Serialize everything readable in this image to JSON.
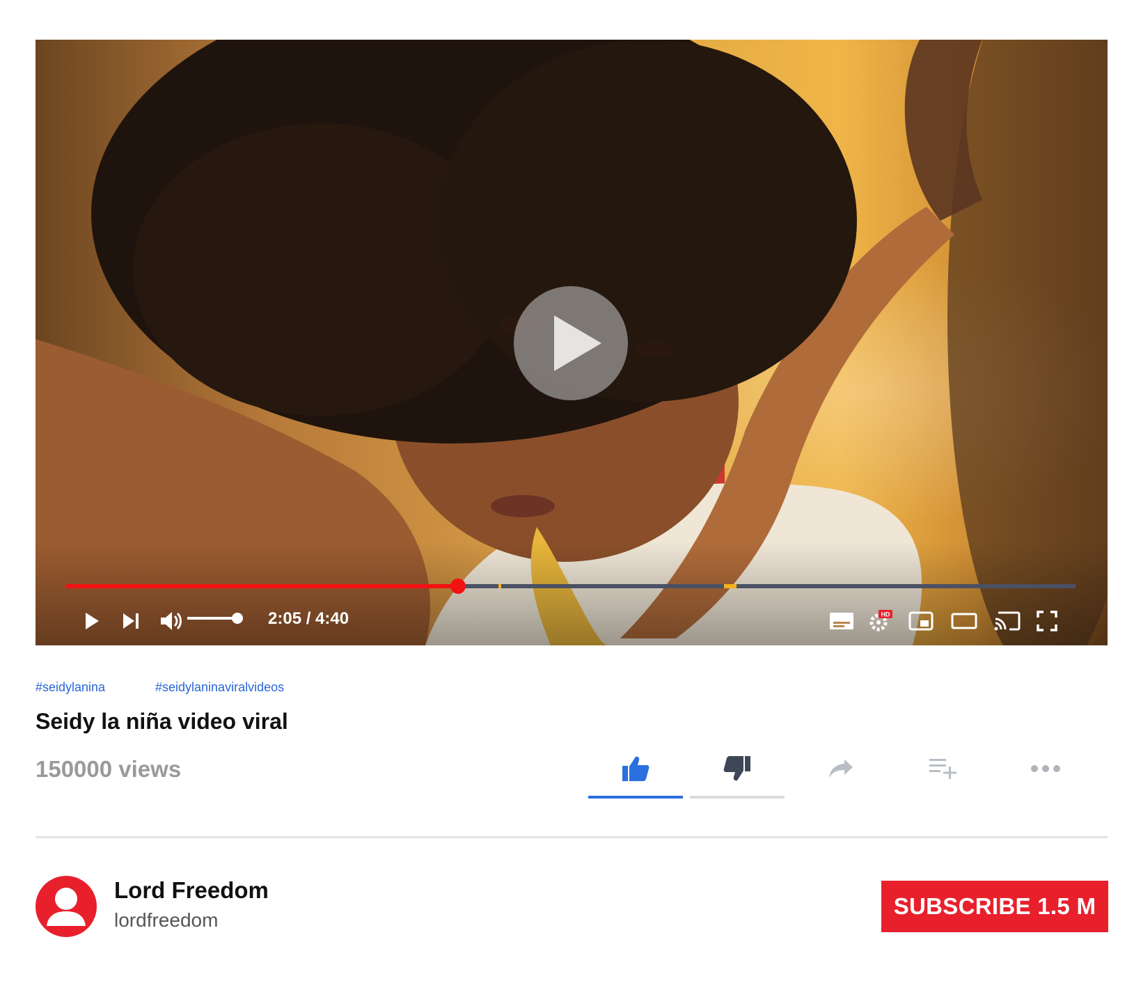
{
  "player": {
    "time_label": "2:05 / 4:40",
    "progress_fraction": 0.388,
    "volume_fraction": 1.0,
    "chapter_marks": [
      0.428,
      0.652
    ],
    "hd_badge": "HD",
    "controls": [
      "play-icon",
      "next-icon",
      "volume-icon",
      "subtitles-icon",
      "settings-icon",
      "miniplayer-icon",
      "theater-icon",
      "cast-icon",
      "fullscreen-icon"
    ]
  },
  "hashtags": [
    "#seidylanina",
    "#seidylaninaviralvideos"
  ],
  "video": {
    "title": "Seidy la niña video viral",
    "views": "150000 views"
  },
  "actions": [
    "like-icon",
    "dislike-icon",
    "share-icon",
    "add-to-playlist-icon",
    "more-icon"
  ],
  "channel": {
    "name": "Lord Freedom",
    "handle": "lordfreedom"
  },
  "subscribe": {
    "label": "SUBSCRIBE 1.5 M"
  },
  "colors": {
    "accent_red": "#e8202c",
    "progress_red": "#f21212",
    "link_blue": "#2a66d9",
    "like_blue": "#2c6fdf",
    "chapter_yellow": "#f2b21a"
  }
}
